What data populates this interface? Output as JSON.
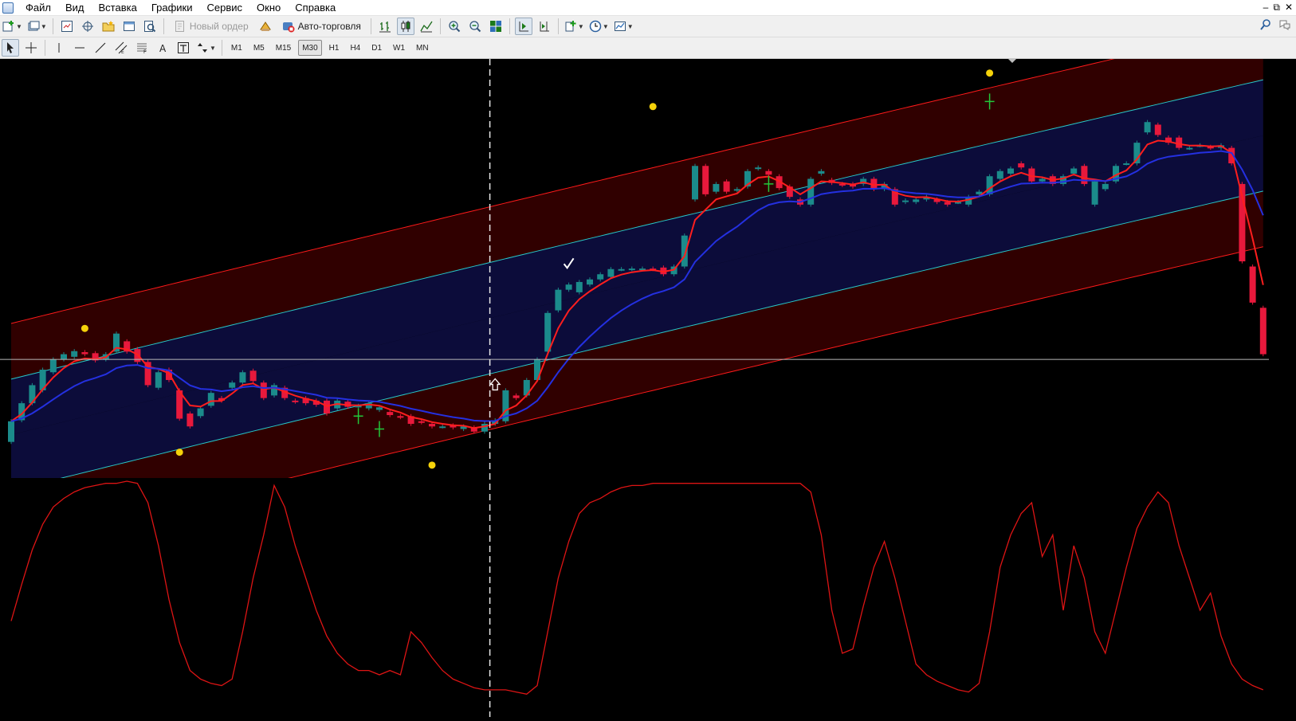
{
  "menu": {
    "items": [
      "Файл",
      "Вид",
      "Вставка",
      "Графики",
      "Сервис",
      "Окно",
      "Справка"
    ]
  },
  "toolbar": {
    "new_order_label": "Новый ордер",
    "auto_trading_label": "Авто-торговля"
  },
  "timeframes": [
    "M1",
    "M5",
    "M15",
    "M30",
    "H1",
    "H4",
    "D1",
    "W1",
    "MN"
  ],
  "active_timeframe": "M30",
  "colors": {
    "bull_candle": "#1b8b8b",
    "bear_candle": "#e8193c",
    "fast_ma": "#ff1e1e",
    "slow_ma": "#2430e0",
    "channel_mid": "#28c8c8",
    "channel_inner_fill": "#0c0c3a",
    "channel_outer_fill": "#300000",
    "signal_dot": "#f5d20a",
    "oscillator": "#dd1414",
    "background": "#000000"
  },
  "chart": {
    "candles": [
      [
        2.2,
        2.6
      ],
      [
        2.62,
        2.95
      ],
      [
        2.95,
        3.3
      ],
      [
        3.2,
        3.6
      ],
      [
        3.55,
        3.8
      ],
      [
        3.8,
        3.9
      ],
      [
        3.85,
        3.96
      ],
      [
        3.94,
        3.9
      ],
      [
        3.92,
        3.78
      ],
      [
        3.8,
        3.9
      ],
      [
        3.95,
        4.3
      ],
      [
        4.15,
        3.95
      ],
      [
        4.0,
        3.75
      ],
      [
        3.75,
        3.3
      ],
      [
        3.25,
        3.55
      ],
      [
        3.6,
        3.4
      ],
      [
        3.2,
        2.65
      ],
      [
        2.75,
        2.5
      ],
      [
        2.7,
        2.85
      ],
      [
        2.9,
        3.15
      ],
      [
        3.05,
        3.0
      ],
      [
        3.25,
        3.35
      ],
      [
        3.35,
        3.55
      ],
      [
        3.58,
        3.38
      ],
      [
        3.35,
        3.05
      ],
      [
        3.1,
        3.3
      ],
      [
        3.25,
        3.05
      ],
      [
        3.0,
        2.98
      ],
      [
        3.05,
        2.95
      ],
      [
        3.0,
        2.92
      ],
      [
        3.0,
        2.75
      ],
      [
        2.85,
        3.0
      ],
      [
        2.98,
        2.88
      ],
      [
        2.9,
        2.9
      ],
      [
        2.85,
        2.95
      ],
      [
        2.82,
        2.87
      ],
      [
        2.78,
        2.72
      ],
      [
        2.7,
        2.68
      ],
      [
        2.7,
        2.55
      ],
      [
        2.6,
        2.58
      ],
      [
        2.55,
        2.5
      ],
      [
        2.5,
        2.5
      ],
      [
        2.52,
        2.48
      ],
      [
        2.45,
        2.5
      ],
      [
        2.48,
        2.4
      ],
      [
        2.4,
        2.55
      ],
      [
        2.55,
        2.62
      ],
      [
        2.6,
        3.2
      ],
      [
        3.1,
        3.05
      ],
      [
        3.1,
        3.4
      ],
      [
        3.4,
        3.8
      ],
      [
        3.95,
        4.7
      ],
      [
        4.75,
        5.15
      ],
      [
        5.15,
        5.25
      ],
      [
        5.1,
        5.3
      ],
      [
        5.25,
        5.35
      ],
      [
        5.35,
        5.45
      ],
      [
        5.4,
        5.55
      ],
      [
        5.55,
        5.55
      ],
      [
        5.55,
        5.56
      ],
      [
        5.56,
        5.56
      ],
      [
        5.56,
        5.55
      ],
      [
        5.58,
        5.45
      ],
      [
        5.45,
        5.6
      ],
      [
        5.6,
        6.2
      ],
      [
        6.9,
        7.55
      ],
      [
        7.55,
        7.0
      ],
      [
        7.05,
        7.2
      ],
      [
        7.25,
        7.05
      ],
      [
        7.08,
        7.1
      ],
      [
        7.15,
        7.45
      ],
      [
        7.5,
        7.52
      ],
      [
        7.45,
        7.38
      ],
      [
        7.35,
        7.12
      ],
      [
        7.15,
        6.95
      ],
      [
        6.9,
        6.8
      ],
      [
        6.8,
        7.3
      ],
      [
        7.4,
        7.45
      ],
      [
        7.28,
        7.22
      ],
      [
        7.2,
        7.18
      ],
      [
        7.2,
        7.15
      ],
      [
        7.2,
        7.3
      ],
      [
        7.3,
        7.1
      ],
      [
        7.1,
        7.2
      ],
      [
        7.1,
        6.8
      ],
      [
        6.85,
        6.88
      ],
      [
        6.85,
        6.9
      ],
      [
        6.9,
        6.95
      ],
      [
        6.9,
        6.85
      ],
      [
        6.85,
        6.8
      ],
      [
        6.85,
        6.85
      ],
      [
        6.8,
        6.95
      ],
      [
        7.0,
        7.05
      ],
      [
        7.0,
        7.35
      ],
      [
        7.3,
        7.45
      ],
      [
        7.4,
        7.5
      ],
      [
        7.6,
        7.52
      ],
      [
        7.5,
        7.25
      ],
      [
        7.25,
        7.3
      ],
      [
        7.35,
        7.2
      ],
      [
        7.2,
        7.35
      ],
      [
        7.4,
        7.5
      ],
      [
        7.55,
        7.2
      ],
      [
        6.8,
        7.25
      ],
      [
        7.1,
        7.2
      ],
      [
        7.25,
        7.55
      ],
      [
        7.6,
        7.6
      ],
      [
        7.6,
        8.0
      ],
      [
        8.2,
        8.4
      ],
      [
        8.35,
        8.15
      ],
      [
        8.1,
        8.0
      ],
      [
        8.1,
        7.9
      ],
      [
        7.9,
        7.9
      ],
      [
        7.95,
        7.95
      ],
      [
        7.92,
        7.9
      ],
      [
        7.9,
        7.95
      ],
      [
        7.9,
        7.6
      ],
      [
        7.2,
        5.7
      ],
      [
        5.6,
        4.9
      ],
      [
        4.8,
        3.9
      ]
    ],
    "oscillator": [
      35,
      52,
      68,
      80,
      88,
      92,
      95,
      97,
      98,
      99,
      99,
      100,
      99,
      90,
      70,
      45,
      25,
      12,
      8,
      6,
      5,
      8,
      30,
      55,
      75,
      98,
      88,
      70,
      55,
      40,
      28,
      20,
      15,
      12,
      12,
      10,
      12,
      10,
      30,
      25,
      18,
      12,
      8,
      6,
      4,
      3,
      3,
      3,
      2,
      1,
      5,
      30,
      55,
      72,
      85,
      90,
      92,
      95,
      97,
      98,
      98,
      99,
      99,
      99,
      99,
      99,
      99,
      99,
      99,
      99,
      99,
      99,
      99,
      99,
      99,
      99,
      95,
      75,
      40,
      20,
      22,
      42,
      60,
      72,
      55,
      35,
      15,
      10,
      7,
      5,
      3,
      2,
      6,
      30,
      60,
      75,
      85,
      90,
      65,
      75,
      40,
      70,
      55,
      30,
      20,
      40,
      60,
      78,
      88,
      95,
      90,
      70,
      55,
      40,
      48,
      28,
      15,
      8,
      5,
      3
    ],
    "signal_dots": [
      {
        "x": 7,
        "y": 4.4
      },
      {
        "x": 16,
        "y": 2.0
      },
      {
        "x": 40,
        "y": 1.75
      },
      {
        "x": 61,
        "y": 8.7
      },
      {
        "x": 93,
        "y": 9.35
      }
    ],
    "markers": [
      {
        "type": "arrow-up",
        "x": 46,
        "y": 3.3
      },
      {
        "type": "checkmark",
        "x": 53,
        "y": 5.65
      },
      {
        "type": "cross",
        "x": 33,
        "y": 2.7
      },
      {
        "type": "cross",
        "x": 35,
        "y": 2.45
      },
      {
        "type": "cross",
        "x": 72,
        "y": 7.2
      },
      {
        "type": "cross",
        "x": 93,
        "y": 8.8
      }
    ],
    "vertical_line_bar": 45,
    "horizontal_line_price": 3.8
  }
}
